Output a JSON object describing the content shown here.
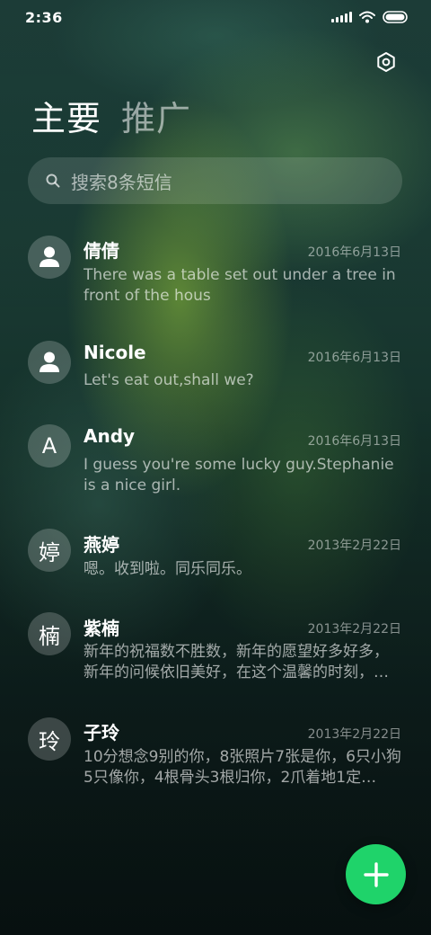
{
  "status_bar": {
    "time": "2:36"
  },
  "tabs": [
    {
      "label": "主要",
      "active": true
    },
    {
      "label": "推广",
      "active": false
    }
  ],
  "search": {
    "placeholder": "搜索8条短信"
  },
  "conversations": [
    {
      "avatar_type": "person-icon",
      "avatar_text": "",
      "name": "倩倩",
      "date": "2016年6月13日",
      "preview": "There was a table set out under a tree in front of the hous"
    },
    {
      "avatar_type": "person-icon",
      "avatar_text": "",
      "name": "Nicole",
      "date": "2016年6月13日",
      "preview": "Let's eat out,shall we?"
    },
    {
      "avatar_type": "letter",
      "avatar_text": "A",
      "name": "Andy",
      "date": "2016年6月13日",
      "preview": "I guess you're some lucky guy.Stephanie is a nice girl."
    },
    {
      "avatar_type": "letter",
      "avatar_text": "婷",
      "name": "燕婷",
      "date": "2013年2月22日",
      "preview": "嗯。收到啦。同乐同乐。"
    },
    {
      "avatar_type": "letter",
      "avatar_text": "楠",
      "name": "紫楠",
      "date": "2013年2月22日",
      "preview": "新年的祝福数不胜数，新年的愿望好多好多，新年的问候依旧美好，在这个温馨的时刻，…"
    },
    {
      "avatar_type": "letter",
      "avatar_text": "玲",
      "name": "子玲",
      "date": "2013年2月22日",
      "preview": "10分想念9别的你，8张照片7张是你，6只小狗5只像你，4根骨头3根归你，2爪着地1定…"
    }
  ],
  "colors": {
    "fab": "#1fd36a",
    "background": "#143029"
  },
  "icons": {
    "settings": "settings-hexagon-icon",
    "search": "search-icon",
    "compose": "plus-icon"
  }
}
